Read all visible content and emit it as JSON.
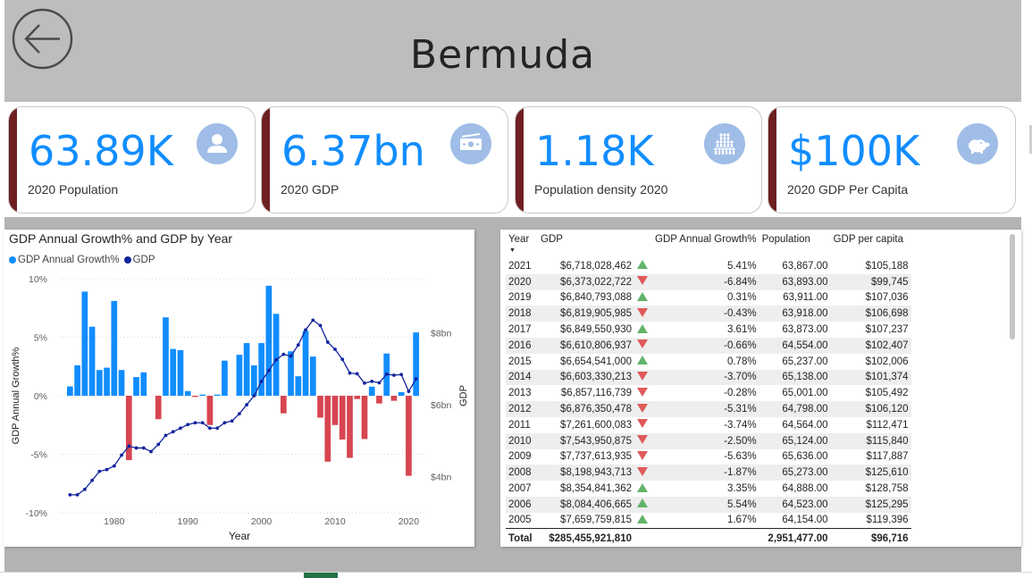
{
  "header": {
    "title": "Bermuda",
    "back_icon": "back-arrow-icon"
  },
  "kpis": [
    {
      "value": "63.89K",
      "label": "2020 Population",
      "icon": "person-icon"
    },
    {
      "value": "6.37bn",
      "label": "2020 GDP",
      "icon": "money-icon"
    },
    {
      "value": "1.18K",
      "label": "Population density 2020",
      "icon": "crowd-icon"
    },
    {
      "value": "$100K",
      "label": "2020 GDP Per Capita",
      "icon": "piggy-bank-icon"
    }
  ],
  "colors": {
    "accent": "#6e1f22",
    "kpi_value": "#118dff",
    "growth_positive": "#118dff",
    "growth_negative": "#d64550",
    "gdp_line": "#12239e",
    "trend_up": "#62b36a",
    "trend_down": "#e05a5a"
  },
  "chart": {
    "title": "GDP Annual Growth% and GDP by Year",
    "legend": [
      {
        "name": "GDP Annual Growth%",
        "color": "#118dff"
      },
      {
        "name": "GDP",
        "color": "#12239e"
      }
    ],
    "xlabel": "Year",
    "ylabel_left": "GDP Annual Growth%",
    "ylabel_right": "GDP",
    "x_ticks": [
      "1980",
      "1990",
      "2000",
      "2010",
      "2020"
    ],
    "y_left_ticks": [
      "10%",
      "5%",
      "0%",
      "-5%",
      "-10%"
    ],
    "y_right_ticks": [
      "$8bn",
      "$6bn",
      "$4bn"
    ]
  },
  "chart_data": {
    "type": "bar+line",
    "title": "GDP Annual Growth% and GDP by Year",
    "xlabel": "Year",
    "ylabel": "GDP Annual Growth%",
    "y2label": "GDP",
    "ylim": [
      -10,
      10
    ],
    "y2lim": [
      3.0,
      9.5
    ],
    "y2_unit": "$bn",
    "legend_position": "top-left",
    "grid": true,
    "x": [
      1974,
      1975,
      1976,
      1977,
      1978,
      1979,
      1980,
      1981,
      1982,
      1983,
      1984,
      1985,
      1986,
      1987,
      1988,
      1989,
      1990,
      1991,
      1992,
      1993,
      1994,
      1995,
      1996,
      1997,
      1998,
      1999,
      2000,
      2001,
      2002,
      2003,
      2004,
      2005,
      2006,
      2007,
      2008,
      2009,
      2010,
      2011,
      2012,
      2013,
      2014,
      2015,
      2016,
      2017,
      2018,
      2019,
      2020,
      2021
    ],
    "series": [
      {
        "name": "GDP Annual Growth%",
        "type": "bar",
        "values": [
          0.8,
          2.6,
          8.9,
          5.9,
          2.2,
          2.4,
          8.1,
          2.2,
          -5.5,
          1.6,
          2.0,
          0.0,
          -2.0,
          6.7,
          4.0,
          3.9,
          0.4,
          -0.1,
          0.1,
          -2.5,
          0.1,
          3.0,
          0.0,
          3.5,
          4.5,
          2.6,
          4.5,
          9.4,
          7.0,
          -1.5,
          3.8,
          1.67,
          5.54,
          3.35,
          -1.87,
          -5.63,
          -2.5,
          -3.74,
          -5.31,
          -0.28,
          -3.7,
          0.78,
          -0.66,
          3.61,
          -0.43,
          0.31,
          -6.84,
          5.41
        ]
      },
      {
        "name": "GDP",
        "type": "line",
        "values": [
          3.5,
          3.5,
          3.65,
          3.9,
          4.15,
          4.2,
          4.3,
          4.6,
          4.85,
          4.8,
          4.8,
          4.7,
          4.9,
          5.15,
          5.25,
          5.35,
          5.45,
          5.5,
          5.5,
          5.35,
          5.35,
          5.5,
          5.55,
          5.75,
          6.0,
          6.25,
          6.65,
          6.95,
          7.25,
          7.4,
          7.35,
          7.66,
          8.08,
          8.35,
          8.2,
          7.74,
          7.54,
          7.26,
          6.88,
          6.86,
          6.6,
          6.65,
          6.61,
          6.85,
          6.82,
          6.84,
          6.37,
          6.72
        ]
      }
    ]
  },
  "table": {
    "headers": [
      "Year",
      "GDP",
      "GDP Annual Growth%",
      "Population",
      "GDP per capita"
    ],
    "rows": [
      {
        "year": "2021",
        "gdp": "$6,718,028,462",
        "trend": "up",
        "growth": "5.41%",
        "population": "63,867.00",
        "per_capita": "$105,188"
      },
      {
        "year": "2020",
        "gdp": "$6,373,022,722",
        "trend": "down",
        "growth": "-6.84%",
        "population": "63,893.00",
        "per_capita": "$99,745"
      },
      {
        "year": "2019",
        "gdp": "$6,840,793,088",
        "trend": "up",
        "growth": "0.31%",
        "population": "63,911.00",
        "per_capita": "$107,036"
      },
      {
        "year": "2018",
        "gdp": "$6,819,905,985",
        "trend": "down",
        "growth": "-0.43%",
        "population": "63,918.00",
        "per_capita": "$106,698"
      },
      {
        "year": "2017",
        "gdp": "$6,849,550,930",
        "trend": "up",
        "growth": "3.61%",
        "population": "63,873.00",
        "per_capita": "$107,237"
      },
      {
        "year": "2016",
        "gdp": "$6,610,806,937",
        "trend": "down",
        "growth": "-0.66%",
        "population": "64,554.00",
        "per_capita": "$102,407"
      },
      {
        "year": "2015",
        "gdp": "$6,654,541,000",
        "trend": "up",
        "growth": "0.78%",
        "population": "65,237.00",
        "per_capita": "$102,006"
      },
      {
        "year": "2014",
        "gdp": "$6,603,330,213",
        "trend": "down",
        "growth": "-3.70%",
        "population": "65,138.00",
        "per_capita": "$101,374"
      },
      {
        "year": "2013",
        "gdp": "$6,857,116,739",
        "trend": "down",
        "growth": "-0.28%",
        "population": "65,001.00",
        "per_capita": "$105,492"
      },
      {
        "year": "2012",
        "gdp": "$6,876,350,478",
        "trend": "down",
        "growth": "-5.31%",
        "population": "64,798.00",
        "per_capita": "$106,120"
      },
      {
        "year": "2011",
        "gdp": "$7,261,600,083",
        "trend": "down",
        "growth": "-3.74%",
        "population": "64,564.00",
        "per_capita": "$112,471"
      },
      {
        "year": "2010",
        "gdp": "$7,543,950,875",
        "trend": "down",
        "growth": "-2.50%",
        "population": "65,124.00",
        "per_capita": "$115,840"
      },
      {
        "year": "2009",
        "gdp": "$7,737,613,935",
        "trend": "down",
        "growth": "-5.63%",
        "population": "65,636.00",
        "per_capita": "$117,887"
      },
      {
        "year": "2008",
        "gdp": "$8,198,943,713",
        "trend": "down",
        "growth": "-1.87%",
        "population": "65,273.00",
        "per_capita": "$125,610"
      },
      {
        "year": "2007",
        "gdp": "$8,354,841,362",
        "trend": "up",
        "growth": "3.35%",
        "population": "64,888.00",
        "per_capita": "$128,758"
      },
      {
        "year": "2006",
        "gdp": "$8,084,406,665",
        "trend": "up",
        "growth": "5.54%",
        "population": "64,523.00",
        "per_capita": "$125,295"
      },
      {
        "year": "2005",
        "gdp": "$7,659,759,815",
        "trend": "up",
        "growth": "1.67%",
        "population": "64,154.00",
        "per_capita": "$119,396"
      }
    ],
    "total": {
      "label": "Total",
      "gdp": "$285,455,921,810",
      "population": "2,951,477.00",
      "per_capita": "$96,716"
    }
  }
}
